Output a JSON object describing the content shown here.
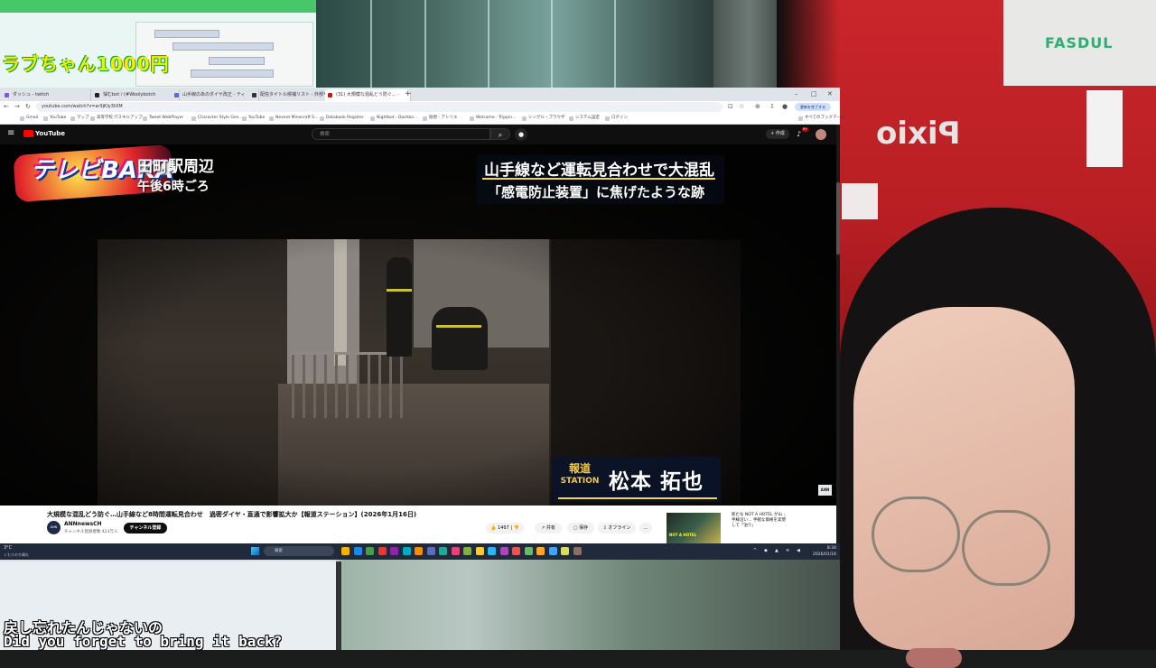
{
  "background": {
    "sticker_text": "ラブちゃん1000円",
    "box_brand": "Pixio",
    "logo_text": "FASDUL",
    "subtitle_jp": "戻し忘れたんじゃないの",
    "subtitle_en": "Did you forget to bring it back?"
  },
  "browser": {
    "tabs": [
      {
        "label": "ダッシュ - twitch",
        "icon_color": "#9146ff"
      },
      {
        "label": "悩むbot / (#Woolybotch",
        "icon_color": "#222222"
      },
      {
        "label": "山手線のあのダイヤ改正 - ティ",
        "icon_color": "#5865f2"
      },
      {
        "label": "配信タイトル候補リスト - 外部サ",
        "icon_color": "#333333"
      },
      {
        "label": "(31) 大規模な混乱どう防ぐ... - ",
        "icon_color": "#ff0000"
      }
    ],
    "new_tab": "+",
    "window_controls": [
      "–",
      "□",
      "✕"
    ],
    "url": "youtube.com/watch?v=ar9jKIy3tXM",
    "nav": [
      "←",
      "→",
      "↻"
    ],
    "finish_update": "更新を完了する",
    "bookmarks": [
      "Gmail",
      "YouTube",
      "マップ",
      "高等学校 ITスキルアップ",
      "Tweet WebPlayer",
      "Character Style Gen...",
      "YouTube",
      "Nevent Minecraft S...",
      "Databook Register",
      "Nightbot - Dashbo...",
      "仮想 - アトリエ",
      "Welcome - Trippin...",
      "シングル・ブラウザ",
      "システム設定",
      "ログイン"
    ],
    "all_bookmarks": "すべてのブックマーク"
  },
  "youtube": {
    "menu_icon": "hamburger-icon",
    "logo": "YouTube",
    "search_placeholder": "検索",
    "create_label": "+ 作成",
    "notif_count": "9+",
    "video_overlay": {
      "show_logo": "テレビBAKA",
      "location": "田町駅周辺",
      "time": "午後6時ごろ",
      "headline1": "山手線など運転見合わせで大混乱",
      "headline2": "「感電防止装置」に焦げたような跡",
      "show_name_top": "報道",
      "show_name_bottom": "STATION",
      "reporter": "松本 拓也",
      "ann_logo": "ANN"
    },
    "video_title": "大規模な混乱どう防ぐ…山手線など8時間運転見合わせ　過密ダイヤ・直通で影響拡大か【報道ステーション】(2026年1月16日)",
    "channel_name": "ANNnewsCH",
    "channel_avatar": "ANN",
    "channel_subs": "チャンネル登録者数 423万人",
    "subscribe": "チャンネル登録",
    "actions": {
      "like": "1467",
      "share": "共有",
      "save": "保存",
      "offline": "オフライン",
      "more": "…"
    },
    "recommended_title": "新たな NOT A HOTEL が山手線沿い… 手軽な価格を実現して「泊り」",
    "recommended_thumb_text": "NOT A HOTEL"
  },
  "taskbar": {
    "weather_temp": "3°C",
    "weather_desc": "くもりのち晴れ",
    "search_label": "検索",
    "time": "8:34",
    "date": "2026/01/16",
    "app_colors": [
      "#f4b400",
      "#1e88e5",
      "#43a047",
      "#e53935",
      "#8e24aa",
      "#00acc1",
      "#fb8c00",
      "#5c6bc0",
      "#26a69a",
      "#ec407a",
      "#7cb342",
      "#ffca28",
      "#29b6f6",
      "#ab47bc",
      "#ef5350",
      "#66bb6a",
      "#ffa726",
      "#42a5f5",
      "#d4e157",
      "#8d6e63"
    ]
  }
}
